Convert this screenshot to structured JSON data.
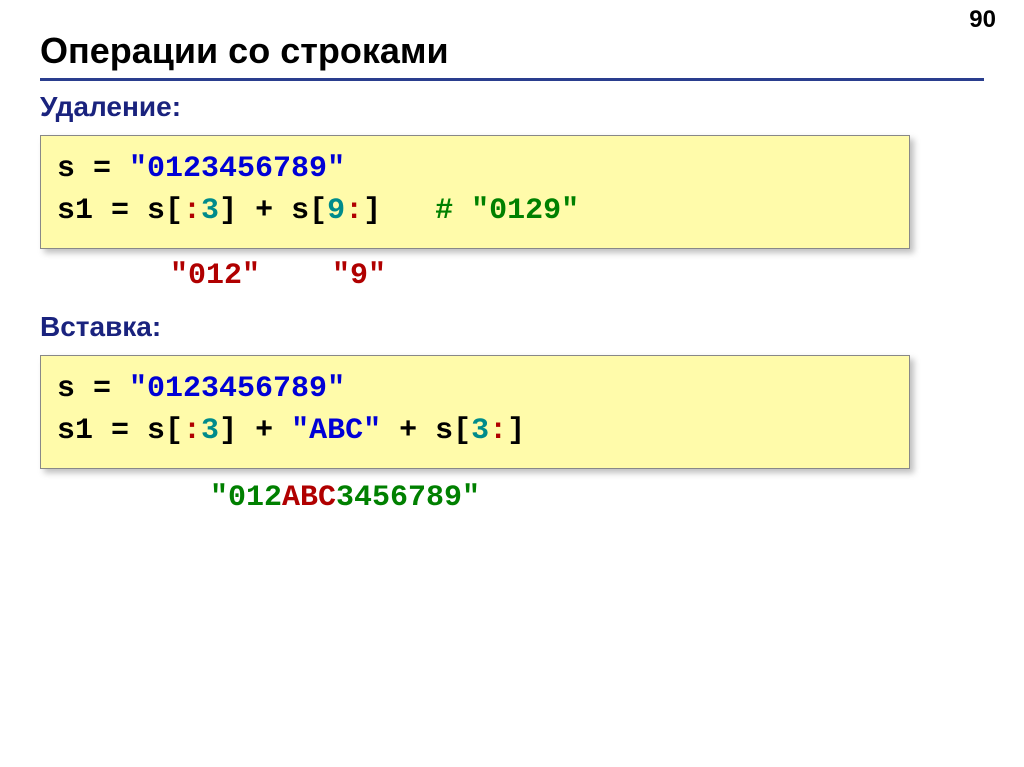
{
  "pageNumber": "90",
  "title": "Операции со строками",
  "delete": {
    "label": "Удаление:",
    "line1_seg1": "s",
    "line1_seg2": " = ",
    "line1_seg3": "\"0123456789\"",
    "line2_seg1": "s1",
    "line2_seg2": " = s[",
    "line2_seg3": ":",
    "line2_seg4": "3",
    "line2_seg5": "] + s[",
    "line2_seg6": "9",
    "line2_seg7": ":",
    "line2_seg8": "]   ",
    "line2_seg9": "# \"0129\"",
    "result_seg1": "\"012\"",
    "result_spacer": "    ",
    "result_seg2": "\"9\""
  },
  "insert": {
    "label": "Вставка:",
    "line1_seg1": "s",
    "line1_seg2": " = ",
    "line1_seg3": "\"0123456789\"",
    "line2_seg1": "s1",
    "line2_seg2": " = s[",
    "line2_seg3": ":",
    "line2_seg4": "3",
    "line2_seg5": "] + ",
    "line2_seg6": "\"ABC\"",
    "line2_seg7": " + s[",
    "line2_seg8": "3",
    "line2_seg9": ":",
    "line2_seg10": "]",
    "result_seg1": "\"012",
    "result_seg2": "ABC",
    "result_seg3": "3456789\""
  }
}
